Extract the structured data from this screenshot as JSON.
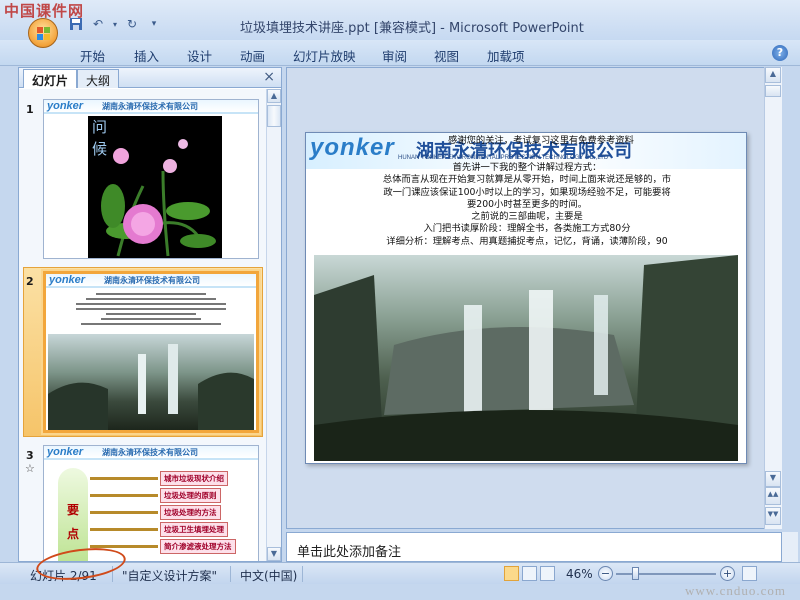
{
  "watermark_top": "中国课件网",
  "window_title": "垃圾填埋技术讲座.ppt [兼容模式] - Microsoft PowerPoint",
  "qat": {
    "save_icon": "save-icon",
    "undo_icon": "undo-icon",
    "redo_icon": "redo-icon",
    "customize_icon": "customize-icon"
  },
  "ribbon_tabs": [
    "开始",
    "插入",
    "设计",
    "动画",
    "幻灯片放映",
    "审阅",
    "视图",
    "加载项"
  ],
  "pane": {
    "tabs": [
      "幻灯片",
      "大纲"
    ],
    "close": "×"
  },
  "thumbs": [
    {
      "num": "1",
      "header": "yonker",
      "header_cn": "湖南永清环保技术有限公司",
      "left_text": "问\n候"
    },
    {
      "num": "2",
      "header": "yonker",
      "header_cn": "湖南永清环保技术有限公司",
      "selected": true
    },
    {
      "num": "3",
      "header": "yonker",
      "header_cn": "湖南永清环保技术有限公司",
      "items": [
        "城市垃圾现状介绍",
        "垃圾处理的原则",
        "垃圾处理的方法",
        "垃圾卫生填埋处理",
        "简介渗滤液处理方法"
      ],
      "left_text": "要\n点",
      "anim_icon": "☆"
    }
  ],
  "slide": {
    "logo": "yonker",
    "logo_cn": "湖南永清环保技术有限公司",
    "logo_en": "HUNAN YONKER ENVIRONMENTAL PROTECTION TECHNOLOGY CO.,LTD",
    "text_lines": [
      "感谢您的关注，考试复习这里有免费参考资料",
      "首先讲一下我的整个讲解过程方式：",
      "总体而言从现在开始复习就算是从零开始，时间上面来说还是够的，市",
      "政一门课应该保证100小时以上的学习，如果现场经验不足，可能要将",
      "要200小时甚至更多的时间。",
      "之前说的三部曲呢，主要是",
      "入门把书读厚阶段：理解全书，各类施工方式80分",
      "详细分析：理解考点、用真题捕捉考点，记忆，背诵，读薄阶段，90"
    ]
  },
  "notes_placeholder": "单击此处添加备注",
  "status": {
    "slide_pos": "幻灯片 2/91",
    "theme": "\"自定义设计方案\"",
    "language": "中文(中国)",
    "zoom": "46%"
  },
  "zoom_level": 0.46,
  "site_watermark": "www.cnduo.com",
  "colors": {
    "accent": "#2a7dc8",
    "selection": "#f2a63b",
    "annotation": "#d04a1a"
  }
}
